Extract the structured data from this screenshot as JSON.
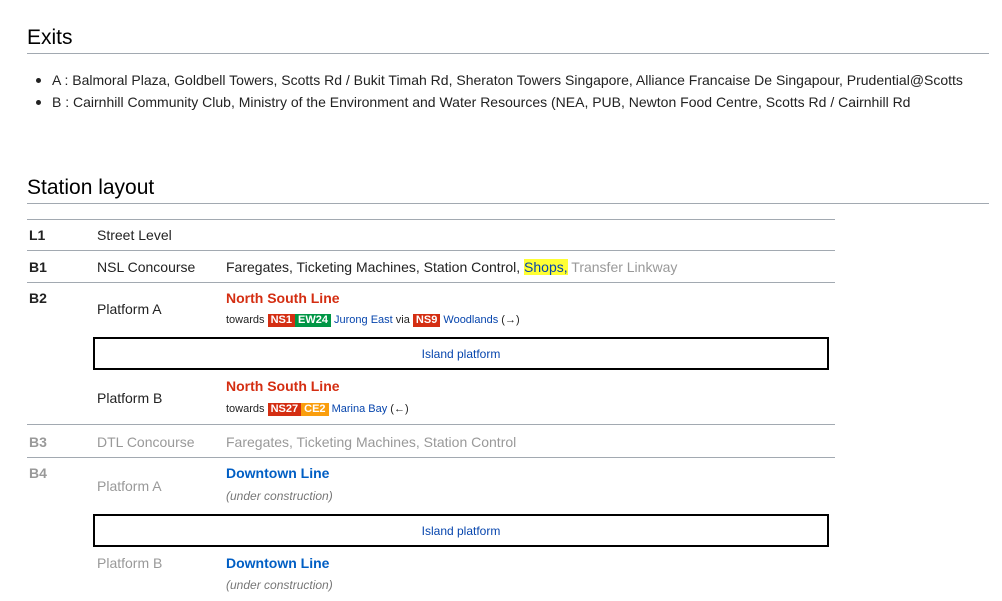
{
  "exits_section": {
    "heading": "Exits",
    "items": [
      {
        "code": "A",
        "text": "A : Balmoral Plaza, Goldbell Towers, Scotts Rd / Bukit Timah Rd, Sheraton Towers Singapore, Alliance Francaise De Singapour, Prudential@Scotts"
      },
      {
        "code": "B",
        "text": "B : Cairnhill Community Club, Ministry of the Environment and Water Resources (NEA, PUB, Newton Food Centre, Scotts Rd / Cairnhill Rd"
      }
    ]
  },
  "layout_section": {
    "heading": "Station layout",
    "rows": {
      "l1": {
        "level": "L1",
        "name": "Street Level"
      },
      "b1": {
        "level": "B1",
        "name": "NSL Concourse",
        "desc_main": "Faregates, Ticketing Machines, Station Control,",
        "desc_shops": "Shops,",
        "desc_transfer": "Transfer Linkway"
      },
      "b2": {
        "level": "B2",
        "platform_a": {
          "name": "Platform A",
          "line": "North South Line",
          "towards": "towards",
          "badges": [
            "NS1",
            "EW24"
          ],
          "dest1": "Jurong East",
          "via": "via",
          "via_badge": "NS9",
          "dest2": "Woodlands",
          "arrow": "(→)"
        },
        "island": "Island platform",
        "platform_b": {
          "name": "Platform B",
          "line": "North South Line",
          "towards": "towards",
          "badges": [
            "NS27",
            "CE2"
          ],
          "dest1": "Marina Bay",
          "arrow": "(←)"
        }
      },
      "b3": {
        "level": "B3",
        "name": "DTL Concourse",
        "desc": "Faregates, Ticketing Machines, Station Control"
      },
      "b4": {
        "level": "B4",
        "platform_a": {
          "name": "Platform A",
          "line": "Downtown Line",
          "status": "(under construction)"
        },
        "island": "Island platform",
        "platform_b": {
          "name": "Platform B",
          "line": "Downtown Line",
          "status": "(under construction)"
        }
      }
    }
  },
  "colors": {
    "nsl_red": "#d42e12",
    "ewl_green": "#009645",
    "ccl_orange": "#fa9e0d",
    "dtl_blue": "#005ec4",
    "link_blue": "#0645ad",
    "highlight_yellow": "#ffff33"
  }
}
